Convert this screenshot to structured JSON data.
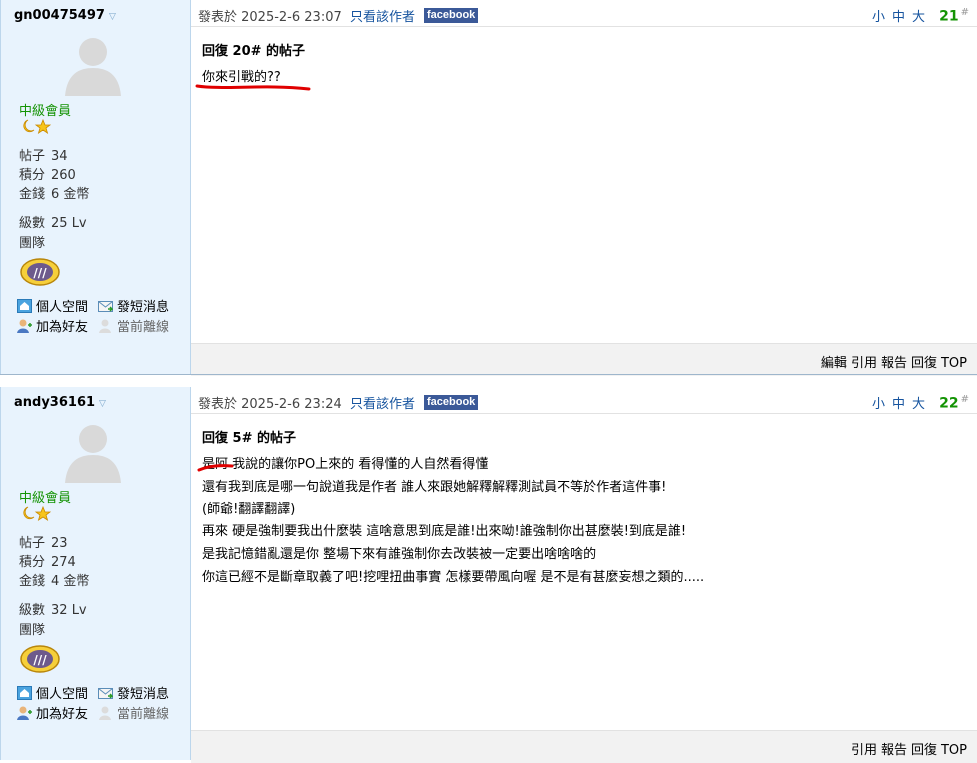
{
  "posts": [
    {
      "username": "gn00475497",
      "rank": "中級會員",
      "stats": [
        {
          "label": "帖子",
          "value": "34"
        },
        {
          "label": "積分",
          "value": "260"
        },
        {
          "label": "金錢",
          "value": "6 金幣"
        }
      ],
      "level": {
        "label": "級數",
        "value": "25 Lv"
      },
      "team_label": "團隊",
      "links": {
        "space": "個人空間",
        "message": "發短消息",
        "friend": "加為好友",
        "status": "當前離線"
      },
      "posted_at": "發表於 2025-2-6 23:07",
      "author_only": "只看該作者",
      "facebook": "facebook",
      "sizes": "小中大",
      "floor": "21",
      "floor_mark": "#",
      "reply_title": "回復 20# 的帖子",
      "body": [
        "你來引戰的??"
      ],
      "actions": [
        "編輯",
        "引用",
        "報告",
        "回復",
        "TOP"
      ]
    },
    {
      "username": "andy36161",
      "rank": "中級會員",
      "stats": [
        {
          "label": "帖子",
          "value": "23"
        },
        {
          "label": "積分",
          "value": "274"
        },
        {
          "label": "金錢",
          "value": "4 金幣"
        }
      ],
      "level": {
        "label": "級數",
        "value": "32 Lv"
      },
      "team_label": "團隊",
      "links": {
        "space": "個人空間",
        "message": "發短消息",
        "friend": "加為好友",
        "status": "當前離線"
      },
      "posted_at": "發表於 2025-2-6 23:24",
      "author_only": "只看該作者",
      "facebook": "facebook",
      "sizes": "小中大",
      "floor": "22",
      "floor_mark": "#",
      "reply_title": "回復 5# 的帖子",
      "body": [
        "是阿 我說的讓你PO上來的 看得懂的人自然看得懂",
        "還有我到底是哪一句說道我是作者 誰人來跟她解釋解釋測試員不等於作者這件事!",
        "(師爺!翻譯翻譯)",
        "再來 硬是強制要我出什麼裝 這啥意思到底是誰!出來呦!誰強制你出甚麼裝!到底是誰!",
        "是我記憶錯亂還是你 整場下來有誰強制你去改裝被一定要出啥啥啥的",
        "你這已經不是斷章取義了吧!挖哩扭曲事實 怎樣要帶風向喔 是不是有甚麼妄想之類的....."
      ],
      "actions": [
        "引用",
        "報告",
        "回復",
        "TOP"
      ]
    }
  ],
  "colors": {
    "rank": "#149304",
    "link": "#15539e",
    "sidebar_bg": "#e8f3fd",
    "facebook": "#3b5998",
    "annotation": "#e00000"
  },
  "icons": [
    "avatar-placeholder-icon",
    "moon-star-icon",
    "team-medal-icon",
    "home-icon",
    "envelope-icon",
    "add-friend-icon",
    "offline-user-icon"
  ]
}
